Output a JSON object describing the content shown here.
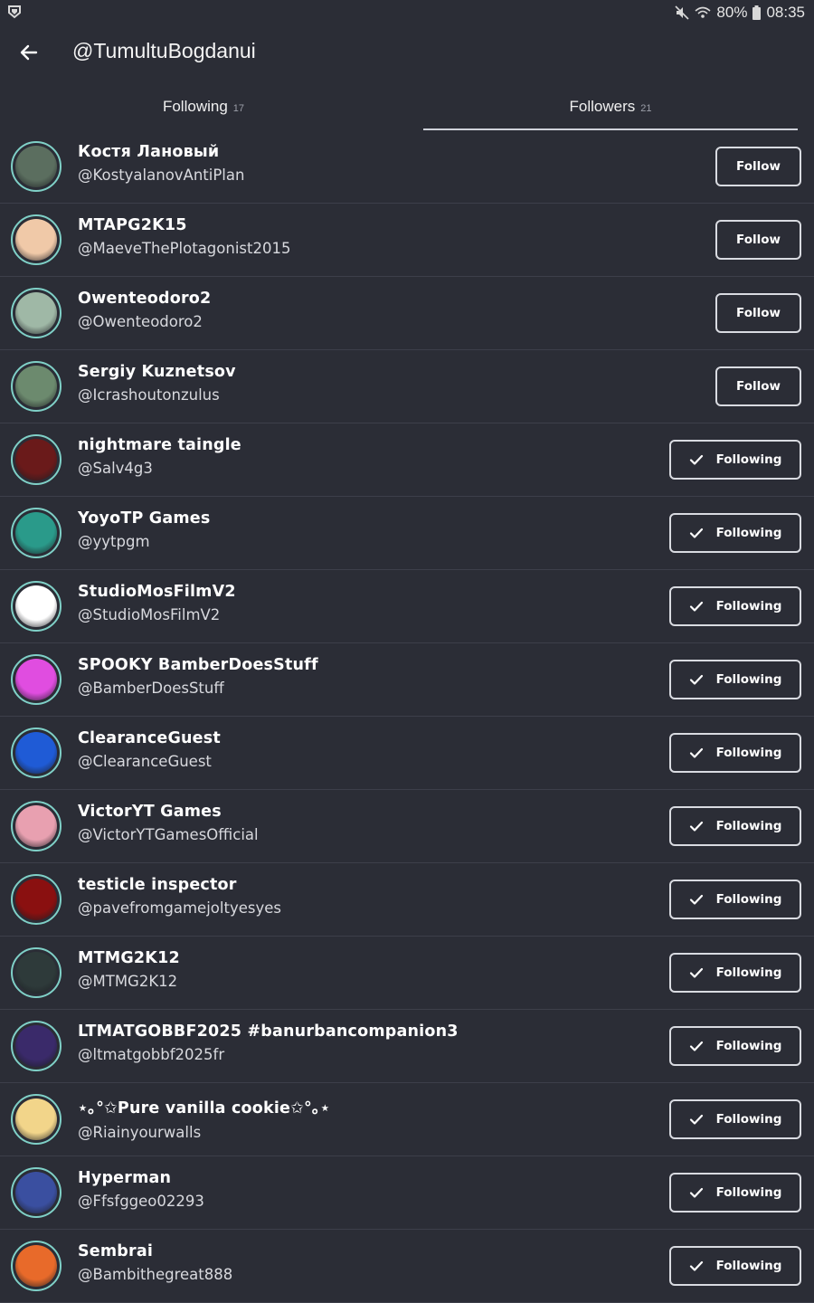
{
  "status_bar": {
    "battery": "80%",
    "time": "08:35"
  },
  "header": {
    "title": "@TumultuBogdanui"
  },
  "tabs": [
    {
      "label": "Following",
      "count": "17"
    },
    {
      "label": "Followers",
      "count": "21"
    }
  ],
  "users": [
    {
      "name": "Костя Лановый",
      "handle": "@KostyalanovAntiPlan",
      "button": "Follow"
    },
    {
      "name": "MTAPG2K15",
      "handle": "@MaeveThePlotagonist2015",
      "button": "Follow"
    },
    {
      "name": "Owenteodoro2",
      "handle": "@Owenteodoro2",
      "button": "Follow"
    },
    {
      "name": "Sergiy Kuznetsov",
      "handle": "@Icrashoutonzulus",
      "button": "Follow"
    },
    {
      "name": "nightmare taingle",
      "handle": "@Salv4g3",
      "button": "Following"
    },
    {
      "name": "YoyoTP Games",
      "handle": "@yytpgm",
      "button": "Following"
    },
    {
      "name": "StudioMosFilmV2",
      "handle": "@StudioMosFilmV2",
      "button": "Following"
    },
    {
      "name": "SPOOKY BamberDoesStuff",
      "handle": "@BamberDoesStuff",
      "button": "Following"
    },
    {
      "name": "ClearanceGuest",
      "handle": "@ClearanceGuest",
      "button": "Following"
    },
    {
      "name": "VictorYT Games",
      "handle": "@VictorYTGamesOfficial",
      "button": "Following"
    },
    {
      "name": "testicle inspector",
      "handle": "@pavefromgamejoltyesyes",
      "button": "Following"
    },
    {
      "name": "MTMG2K12",
      "handle": "@MTMG2K12",
      "button": "Following"
    },
    {
      "name": "LTMATGOBBF2025 #banurbancompanion3",
      "handle": "@ltmatgobbf2025fr",
      "button": "Following"
    },
    {
      "name": "⋆｡°✩Pure vanilla cookie✩°｡⋆",
      "handle": "@Riainyourwalls",
      "button": "Following"
    },
    {
      "name": "Hyperman",
      "handle": "@Ffsfggeo02293",
      "button": "Following"
    },
    {
      "name": "Sembrai",
      "handle": "@Bambithegreat888",
      "button": "Following"
    }
  ],
  "avatar_colors": [
    "#5b6e5f",
    "#f0c9a8",
    "#9fb8a6",
    "#6c8a6e",
    "#6a1a1a",
    "#2a9a8a",
    "#ffffff",
    "#e04de0",
    "#1f5bd6",
    "#e8a0b0",
    "#8a1010",
    "#2e3a3a",
    "#3a2a6a",
    "#f2d58a",
    "#3a4fa0",
    "#e86a2a"
  ],
  "colors": {
    "background": "#2b2d36",
    "divider": "#3d3f4a",
    "accent": "#cfd2da"
  }
}
